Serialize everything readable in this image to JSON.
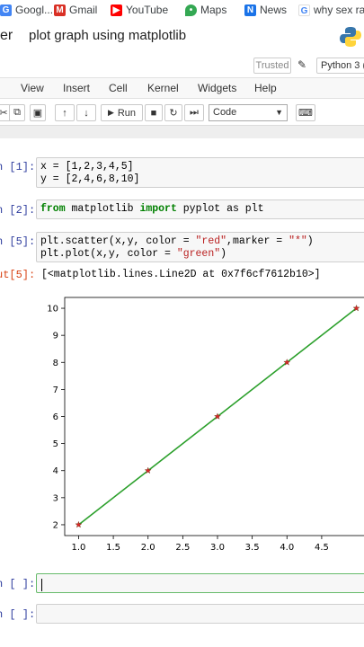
{
  "browser": {
    "bookmarks": [
      {
        "label": "Googl...",
        "icon": "google-icon",
        "color": "#4285f4"
      },
      {
        "label": "Gmail",
        "icon": "gmail-icon",
        "color": "#d93025"
      },
      {
        "label": "YouTube",
        "icon": "youtube-icon",
        "color": "#ff0000"
      },
      {
        "label": "Maps",
        "icon": "maps-icon",
        "color": "#34a853"
      },
      {
        "label": "News",
        "icon": "news-icon",
        "color": "#1a73e8"
      },
      {
        "label": "why sex ra",
        "icon": "google-g-icon",
        "color": "#4285f4"
      }
    ]
  },
  "jupyter": {
    "logo_text": "er",
    "notebook_title": "plot graph using matplotlib",
    "trusted_label": "Trusted",
    "kernel_label": "Python 3 (",
    "menu": [
      "View",
      "Insert",
      "Cell",
      "Kernel",
      "Widgets",
      "Help"
    ],
    "toolbar": {
      "run_label": "Run",
      "cell_type": "Code"
    }
  },
  "cells": {
    "c1": {
      "prompt": "n [1]:",
      "line1": "x = [1,2,3,4,5]",
      "line2": "y = [2,4,6,8,10]"
    },
    "c2": {
      "prompt": "n [2]:",
      "kw_from": "from",
      "mod": " matplotlib ",
      "kw_import": "import",
      "rest": " pyplot as plt"
    },
    "c3": {
      "prompt": "n [5]:",
      "line1_a": "plt.scatter(x,y, color = ",
      "line1_s1": "\"red\"",
      "line1_b": ",marker = ",
      "line1_s2": "\"*\"",
      "line1_c": ")",
      "line2_a": "plt.plot(x,y, color = ",
      "line2_s": "\"green\"",
      "line2_b": ")",
      "out_prompt": "ut[5]:",
      "out_text": "[<matplotlib.lines.Line2D at 0x7f6cf7612b10>]"
    },
    "c4": {
      "prompt": "n [ ]:"
    },
    "c5": {
      "prompt": "n [ ]:"
    }
  },
  "chart_data": {
    "type": "line",
    "series": [
      {
        "x": [
          1,
          2,
          3,
          4,
          5
        ],
        "values": [
          2,
          4,
          6,
          8,
          10
        ],
        "color": "#2ca02c",
        "style": "line"
      },
      {
        "x": [
          1,
          2,
          3,
          4,
          5
        ],
        "values": [
          2,
          4,
          6,
          8,
          10
        ],
        "color": "#d62728",
        "style": "scatter-star"
      }
    ],
    "xticks": [
      "1.0",
      "1.5",
      "2.0",
      "2.5",
      "3.0",
      "3.5",
      "4.0",
      "4.5"
    ],
    "yticks": [
      "2",
      "3",
      "4",
      "5",
      "6",
      "7",
      "8",
      "9",
      "10"
    ],
    "xlim": [
      0.8,
      5.2
    ],
    "ylim": [
      1.6,
      10.4
    ],
    "grid": false
  }
}
